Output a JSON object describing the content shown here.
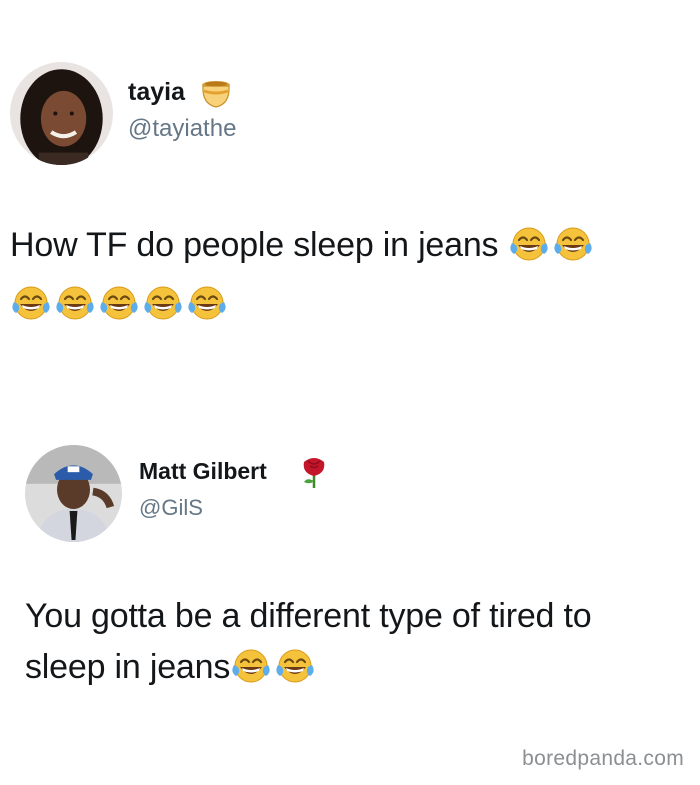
{
  "tweets": [
    {
      "name": "tayia",
      "handle": "@tayiathe",
      "badge_icon": "honey-pot-icon",
      "text": "How TF do people sleep in jeans",
      "emojis_inline": 2,
      "emojis_row": 5,
      "emoji_icon": "tears-of-joy-emoji"
    },
    {
      "name": "Matt Gilbert",
      "handle": "@GilS",
      "badge_icon": "rose-icon",
      "text_line1": "You gotta be a different type of tired to",
      "text_line2": "sleep in jeans",
      "emojis_inline": 2,
      "emoji_icon": "tears-of-joy-emoji"
    }
  ],
  "watermark": "boredpanda.com",
  "colors": {
    "name": "#14171a",
    "handle": "#657786",
    "watermark": "#8b8f92",
    "emoji_face": "#f5c33b",
    "emoji_tear": "#5dadec"
  }
}
